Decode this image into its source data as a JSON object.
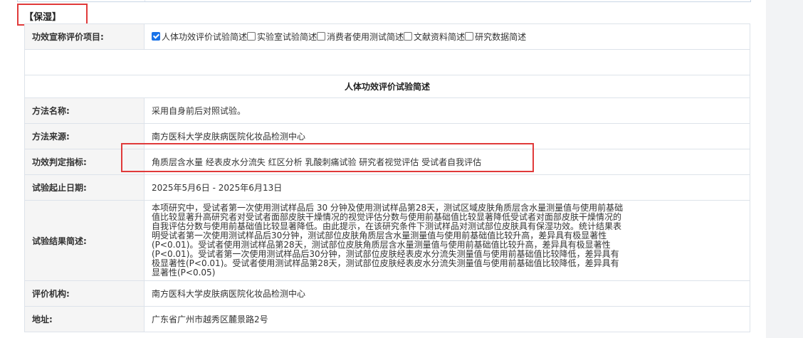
{
  "section": {
    "title": "【保湿】"
  },
  "claims": {
    "label": "功效宣称评价项目:",
    "options": [
      {
        "label": "人体功效评价试验简述",
        "checked": true
      },
      {
        "label": "实验室试验简述",
        "checked": false
      },
      {
        "label": "消费者使用测试简述",
        "checked": false
      },
      {
        "label": "文献资料简述",
        "checked": false
      },
      {
        "label": "研究数据简述",
        "checked": false
      }
    ]
  },
  "subsection": {
    "title": "人体功效评价试验简述"
  },
  "rows": {
    "method_name": {
      "label": "方法名称:",
      "value": "采用自身前后对照试验。"
    },
    "method_source": {
      "label": "方法来源:",
      "value": "南方医科大学皮肤病医院化妆品检测中心"
    },
    "indicators": {
      "label": "功效判定指标:",
      "value": "角质层含水量 经表皮水分流失 红区分析 乳酸刺痛试验 研究者视觉评估 受试者自我评估"
    },
    "dates": {
      "label": "试验起止日期:",
      "value": "2025年5月6日 - 2025年6月13日"
    },
    "results": {
      "label": "试验结果简述:",
      "value": "本项研究中，受试者第一次使用测试样品后 30 分钟及使用测试样品第28天，测试区域皮肤角质层含水量测量值与使用前基础值比较显著升高研究者对受试者面部皮肤干燥情况的视觉评估分数与使用前基础值比较显著降低受试者对面部皮肤干燥情况的自我评估分数与使用前基础值比较显著降低。由此提示，在该研究条件下测试样品对测试部位皮肤具有保湿功效。统计结果表明受试者第一次使用测试样品后30分钟，测试部位皮肤角质层含水量测量值与使用前基础值比较升高，差异具有极显著性(P<0.01)。受试者使用测试样品第28天，测试部位皮肤角质层含水量测量值与使用前基础值比较升高，差异具有极显著性(P<0.01)。受试者第一次使用测试样品后30分钟，测试部位皮肤经表皮水分流失测量值与使用前基础值比较降低，差异具有极显著性(P<0.01)。受试者使用测试样品第28天，测试部位皮肤经表皮水分流失测量值与使用前基础值比较降低，差异具有显著性(P<0.05)"
    },
    "institution": {
      "label": "评价机构:",
      "value": "南方医科大学皮肤病医院化妆品检测中心"
    },
    "address": {
      "label": "地址:",
      "value": "广东省广州市越秀区麓景路2号"
    }
  },
  "colors": {
    "highlight": "#e03a3a",
    "label_bg": "#f5f5f5",
    "border": "#dde3ea",
    "checkbox": "#1a73e8"
  }
}
